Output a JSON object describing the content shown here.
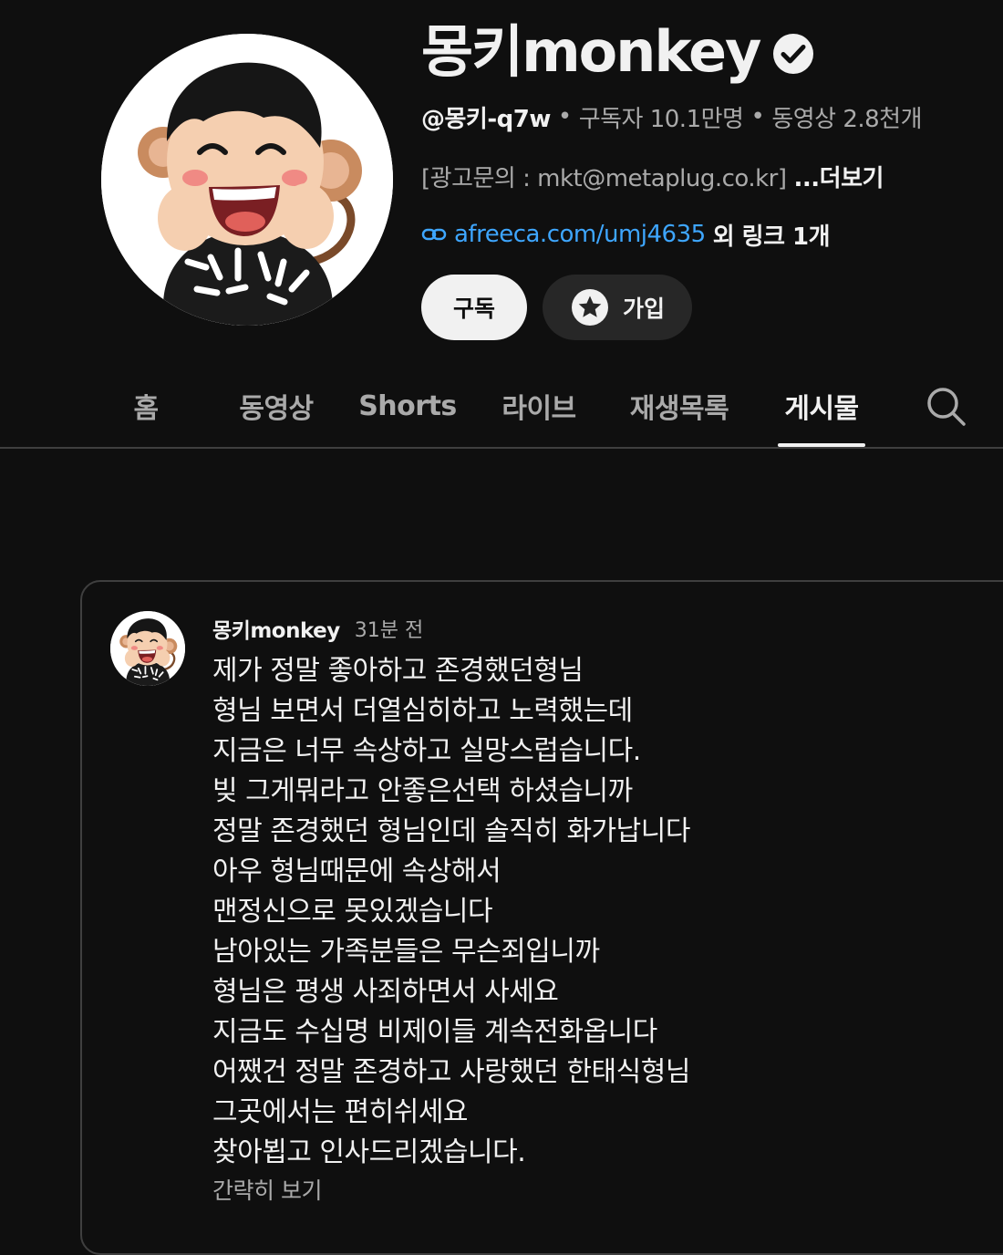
{
  "channel": {
    "title": "몽키monkey",
    "handle": "@몽키-q7w",
    "subscribers": "구독자 10.1만명",
    "videos": "동영상 2.8천개",
    "separator": "•",
    "description": "[광고문의 : mkt@metaplug.co.kr]",
    "more_label": "...더보기",
    "link_text": "afreeca.com/umj4635",
    "link_extra": "외 링크 1개",
    "verified_icon": "verified-check-icon",
    "avatar_icon": "monkey-boy-avatar"
  },
  "buttons": {
    "subscribe_label": "구독",
    "join_label": "가입",
    "join_icon": "star-badge-icon"
  },
  "tabs": [
    {
      "label": "홈",
      "active": false
    },
    {
      "label": "동영상",
      "active": false
    },
    {
      "label": "Shorts",
      "active": false
    },
    {
      "label": "라이브",
      "active": false
    },
    {
      "label": "재생목록",
      "active": false
    },
    {
      "label": "게시물",
      "active": true
    }
  ],
  "post": {
    "author": "몽키monkey",
    "time": "31분 전",
    "lines": [
      "제가 정말 좋아하고 존경했던형님",
      "형님 보면서 더열심히하고 노력했는데",
      "지금은 너무 속상하고 실망스럽습니다.",
      "빚 그게뭐라고 안좋은선택 하셨습니까",
      "정말 존경했던 형님인데 솔직히 화가납니다",
      "아우 형님때문에 속상해서",
      "맨정신으로 못있겠습니다",
      "남아있는 가족분들은 무슨죄입니까",
      "형님은 평생 사죄하면서 사세요",
      "지금도 수십명 비제이들 계속전화옵니다",
      "어쨌건 정말 존경하고 사랑했던 한태식형님",
      "그곳에서는 편히쉬세요",
      "찾아뵙고 인사드리겠습니다."
    ],
    "toggle_label": "간략히 보기"
  },
  "colors": {
    "background": "#0f0f0f",
    "text_primary": "#f1f1f1",
    "text_secondary": "#aaaaaa",
    "link": "#3ea6ff",
    "border": "#3f3f3f",
    "join_button_bg": "#272727"
  }
}
